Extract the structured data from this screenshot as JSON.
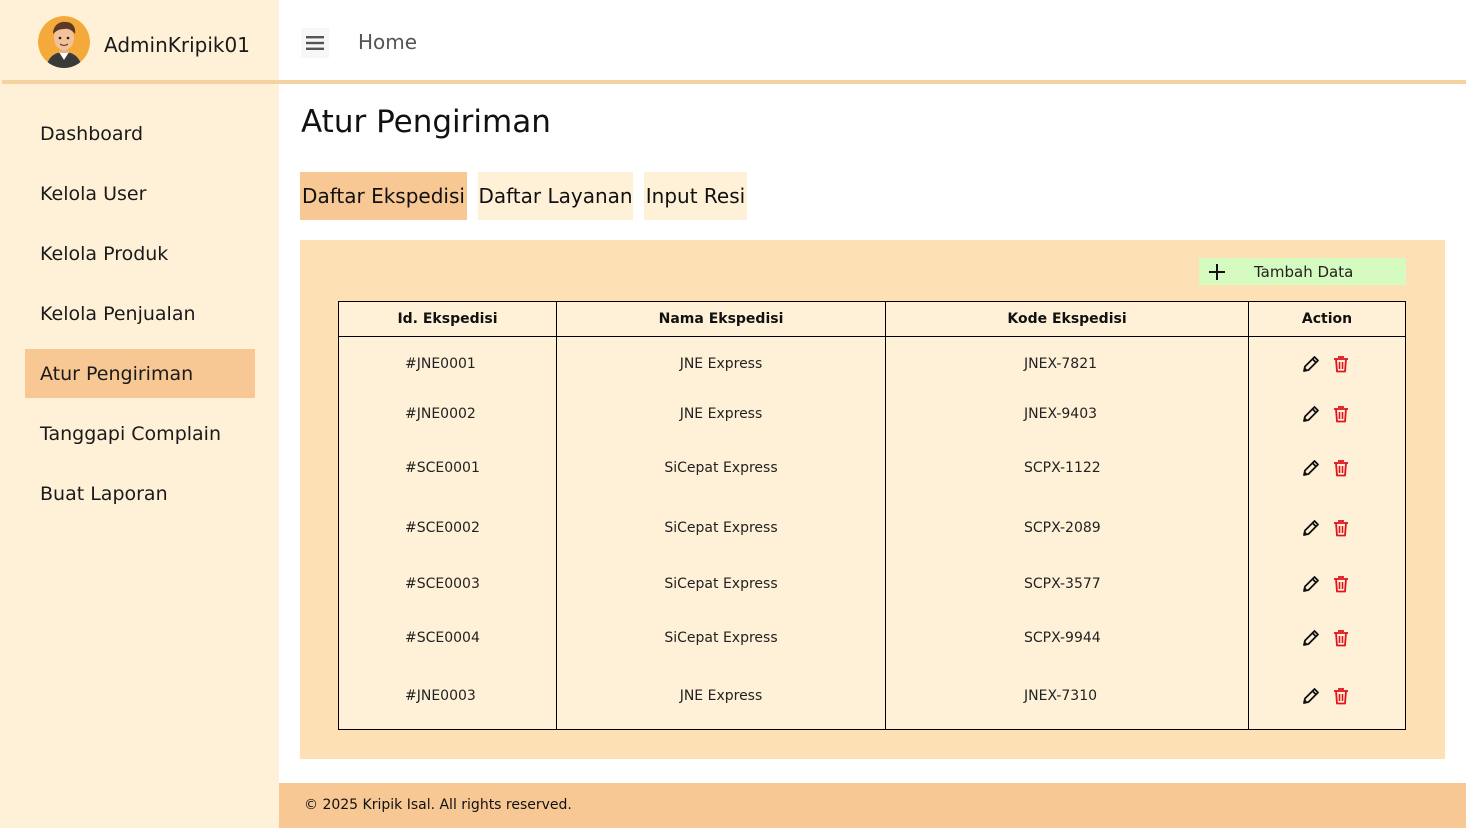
{
  "sidebar": {
    "admin_name": "AdminKripik01",
    "items": [
      {
        "label": "Dashboard",
        "active": false
      },
      {
        "label": "Kelola User",
        "active": false
      },
      {
        "label": "Kelola Produk",
        "active": false
      },
      {
        "label": "Kelola Penjualan",
        "active": false
      },
      {
        "label": "Atur Pengiriman",
        "active": true
      },
      {
        "label": "Tanggapi Complain",
        "active": false
      },
      {
        "label": "Buat Laporan",
        "active": false
      }
    ]
  },
  "topbar": {
    "menu_icon": "hamburger-icon",
    "breadcrumb": "Home"
  },
  "main": {
    "title": "Atur Pengiriman",
    "tabs": [
      {
        "label": "Daftar Ekspedisi",
        "active": true
      },
      {
        "label": "Daftar Layanan",
        "active": false
      },
      {
        "label": "Input Resi",
        "active": false
      }
    ],
    "add_button": "Tambah Data",
    "table": {
      "headers": [
        "Id. Ekspedisi",
        "Nama Ekspedisi",
        "Kode Ekspedisi",
        "Action"
      ],
      "rows": [
        {
          "id": "#JNE0001",
          "nama": "JNE Express",
          "kode": "JNEX-7821"
        },
        {
          "id": "#JNE0002",
          "nama": "JNE Express",
          "kode": "JNEX-9403"
        },
        {
          "id": "#SCE0001",
          "nama": "SiCepat Express",
          "kode": "SCPX-1122"
        },
        {
          "id": "#SCE0002",
          "nama": "SiCepat Express",
          "kode": "SCPX-2089"
        },
        {
          "id": "#SCE0003",
          "nama": "SiCepat Express",
          "kode": "SCPX-3577"
        },
        {
          "id": "#SCE0004",
          "nama": "SiCepat Express",
          "kode": "SCPX-9944"
        },
        {
          "id": "#JNE0003",
          "nama": "JNE Express",
          "kode": "JNEX-7310"
        }
      ]
    }
  },
  "footer": {
    "text": "© 2025 Kripik Isal. All rights reserved."
  },
  "colors": {
    "sidebar_bg": "#fff1d7",
    "active_bg": "#f8c894",
    "panel_bg": "#fde0b3",
    "add_button_bg": "#d5fbc0",
    "delete_icon": "#e0141e"
  }
}
